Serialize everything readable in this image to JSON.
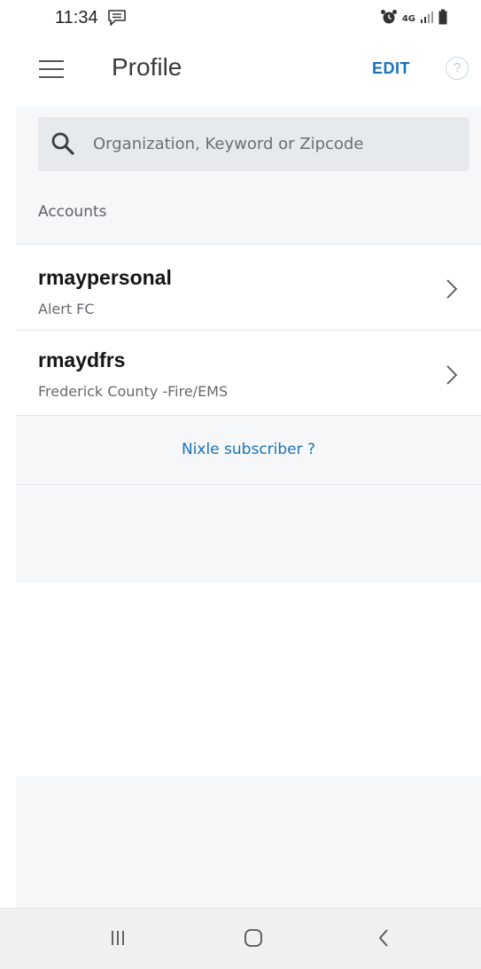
{
  "status_bar": {
    "time": "11:34",
    "network_label": "4G"
  },
  "app_bar": {
    "title": "Profile",
    "edit_label": "EDIT",
    "help_label": "?"
  },
  "search": {
    "placeholder": "Organization, Keyword or Zipcode",
    "value": ""
  },
  "accounts": {
    "section_label": "Accounts",
    "items": [
      {
        "name": "rmaypersonal",
        "org": "Alert FC"
      },
      {
        "name": "rmaydfrs",
        "org": "Frederick County -Fire/EMS"
      }
    ]
  },
  "subscriber": {
    "link_text": "Nixle subscriber ?"
  },
  "colors": {
    "accent": "#1a73b8",
    "panel": "#f5f7f8",
    "search_bg": "#e6eaed"
  },
  "icons": {
    "menu": "hamburger-menu-icon",
    "help": "help-circle-icon",
    "search": "search-icon",
    "chevron": "chevron-right-icon",
    "nav_recents": "recent-apps-icon",
    "nav_home": "home-icon",
    "nav_back": "back-icon"
  }
}
